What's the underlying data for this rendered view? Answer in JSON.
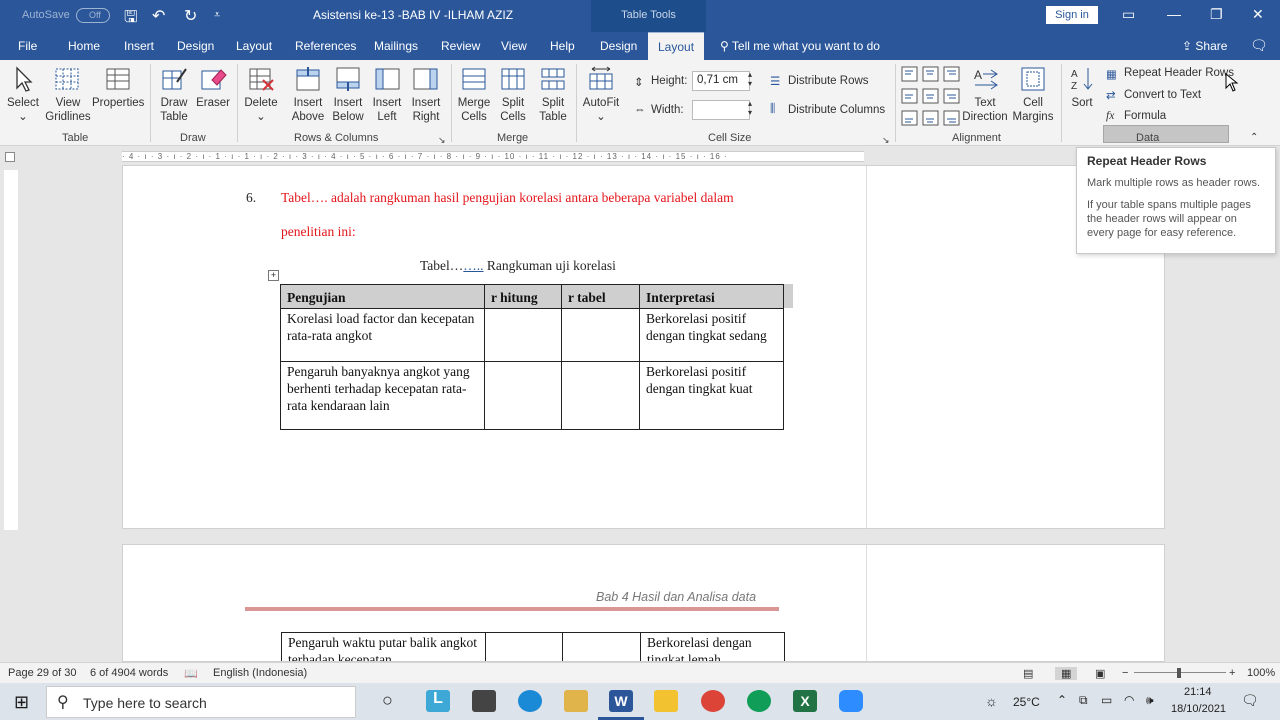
{
  "titlebar": {
    "autosave": "AutoSave",
    "autosave_state": "Off",
    "document_title": "Asistensi ke-13 -BAB IV -ILHAM AZIZ",
    "context_tab": "Table Tools",
    "signin": "Sign in"
  },
  "tabs": [
    "File",
    "Home",
    "Insert",
    "Design",
    "Layout",
    "References",
    "Mailings",
    "Review",
    "View",
    "Help",
    "Design",
    "Layout"
  ],
  "tellme": "Tell me what you want to do",
  "share": "Share",
  "ribbon": {
    "table": {
      "select": "Select",
      "view_gridlines": "View Gridlines",
      "properties": "Properties",
      "group": "Table"
    },
    "draw": {
      "draw_table": "Draw Table",
      "eraser": "Eraser",
      "group": "Draw"
    },
    "rows_columns": {
      "delete": "Delete",
      "insert_above": "Insert Above",
      "insert_below": "Insert Below",
      "insert_left": "Insert Left",
      "insert_right": "Insert Right",
      "group": "Rows & Columns"
    },
    "merge": {
      "merge_cells": "Merge Cells",
      "split_cells": "Split Cells",
      "split_table": "Split Table",
      "group": "Merge"
    },
    "cell_size": {
      "autofit": "AutoFit",
      "height_label": "Height:",
      "height_value": "0,71 cm",
      "width_label": "Width:",
      "width_value": "",
      "distribute_rows": "Distribute Rows",
      "distribute_columns": "Distribute Columns",
      "group": "Cell Size"
    },
    "alignment": {
      "text_direction": "Text Direction",
      "cell_margins": "Cell Margins",
      "group": "Alignment"
    },
    "data": {
      "sort": "Sort",
      "repeat_header_rows": "Repeat Header Rows",
      "convert_to_text": "Convert to Text",
      "formula": "Formula",
      "group": "Data"
    }
  },
  "tooltip": {
    "title": "Repeat Header Rows",
    "line1": "Mark multiple rows as header rows.",
    "line2": "If your table spans multiple pages the header rows will appear on every page for easy reference."
  },
  "document": {
    "item_number": "6.",
    "red_line1": "Tabel…. adalah rangkuman hasil pengujian korelasi antara beberapa variabel dalam",
    "red_line2": "penelitian ini:",
    "caption_prefix": "Tabel…",
    "caption_link": "…..",
    "caption_rest": " Rangkuman uji korelasi",
    "table_headers": [
      "Pengujian",
      "r hitung",
      "r tabel",
      "Interpretasi"
    ],
    "rows": [
      [
        "Korelasi load factor dan kecepatan rata-rata angkot",
        "",
        "",
        "Berkorelasi positif dengan tingkat sedang"
      ],
      [
        "Pengaruh banyaknya angkot yang berhenti terhadap kecepatan rata-rata kendaraan lain",
        "",
        "",
        "Berkorelasi positif dengan tingkat kuat"
      ]
    ],
    "page2_header": "Bab 4 Hasil dan Analisa data",
    "page2_row": [
      "Pengaruh waktu putar balik angkot terhadap kecepatan",
      "",
      "",
      "Berkorelasi dengan tingkat lemah"
    ]
  },
  "statusbar": {
    "page": "Page 29 of 30",
    "words": "6 of 4904 words",
    "language": "English (Indonesia)",
    "zoom": "100%"
  },
  "taskbar": {
    "search_placeholder": "Type here to search",
    "temperature": "25°C",
    "time": "21:14",
    "date": "18/10/2021"
  }
}
